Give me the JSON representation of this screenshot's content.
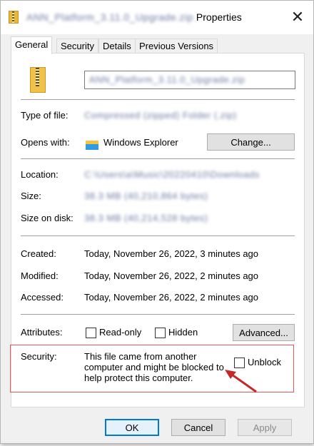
{
  "window": {
    "title_blurred": "ANN_Platform_3.11.0_Upgrade.zip",
    "title_suffix": "Properties",
    "close_glyph": "✕"
  },
  "tabs": [
    {
      "label": "General",
      "active": true
    },
    {
      "label": "Security",
      "active": false
    },
    {
      "label": "Details",
      "active": false
    },
    {
      "label": "Previous Versions",
      "active": false
    }
  ],
  "file": {
    "name_blurred": "ANN_Platform_3.11.0_Upgrade.zip",
    "type_label": "Type of file:",
    "type_value_blurred": "Compressed (zipped) Folder (.zip)",
    "opens_label": "Opens with:",
    "opens_value": "Windows Explorer",
    "change_button": "Change...",
    "location_label": "Location:",
    "location_value_blurred": "C:\\Users\\a\\Music\\20220410\\Downloads",
    "size_label": "Size:",
    "size_value_blurred": "38.3 MB (40,210,864 bytes)",
    "size_disk_label": "Size on disk:",
    "size_disk_value_blurred": "38.3 MB (40,214,528 bytes)",
    "created_label": "Created:",
    "created_value": "Today, November 26, 2022, 3 minutes ago",
    "modified_label": "Modified:",
    "modified_value": "Today, November 26, 2022, 2 minutes ago",
    "accessed_label": "Accessed:",
    "accessed_value": "Today, November 26, 2022, 2 minutes ago",
    "attributes_label": "Attributes:",
    "readonly_label": "Read-only",
    "hidden_label": "Hidden",
    "advanced_button": "Advanced...",
    "security_label": "Security:",
    "security_line1": "This file came from another",
    "security_line2": "computer and might be blocked to",
    "security_line3": "help protect this computer.",
    "unblock_label": "Unblock"
  },
  "buttons": {
    "ok": "OK",
    "cancel": "Cancel",
    "apply": "Apply"
  },
  "colors": {
    "highlight": "#e05a5a",
    "arrow": "#c62828",
    "ok_border": "#0078d7"
  },
  "icons": {
    "title": "zip-folder-icon",
    "file": "zip-folder-icon",
    "opens": "file-explorer-icon",
    "arrow": "red-arrow-annotation"
  }
}
